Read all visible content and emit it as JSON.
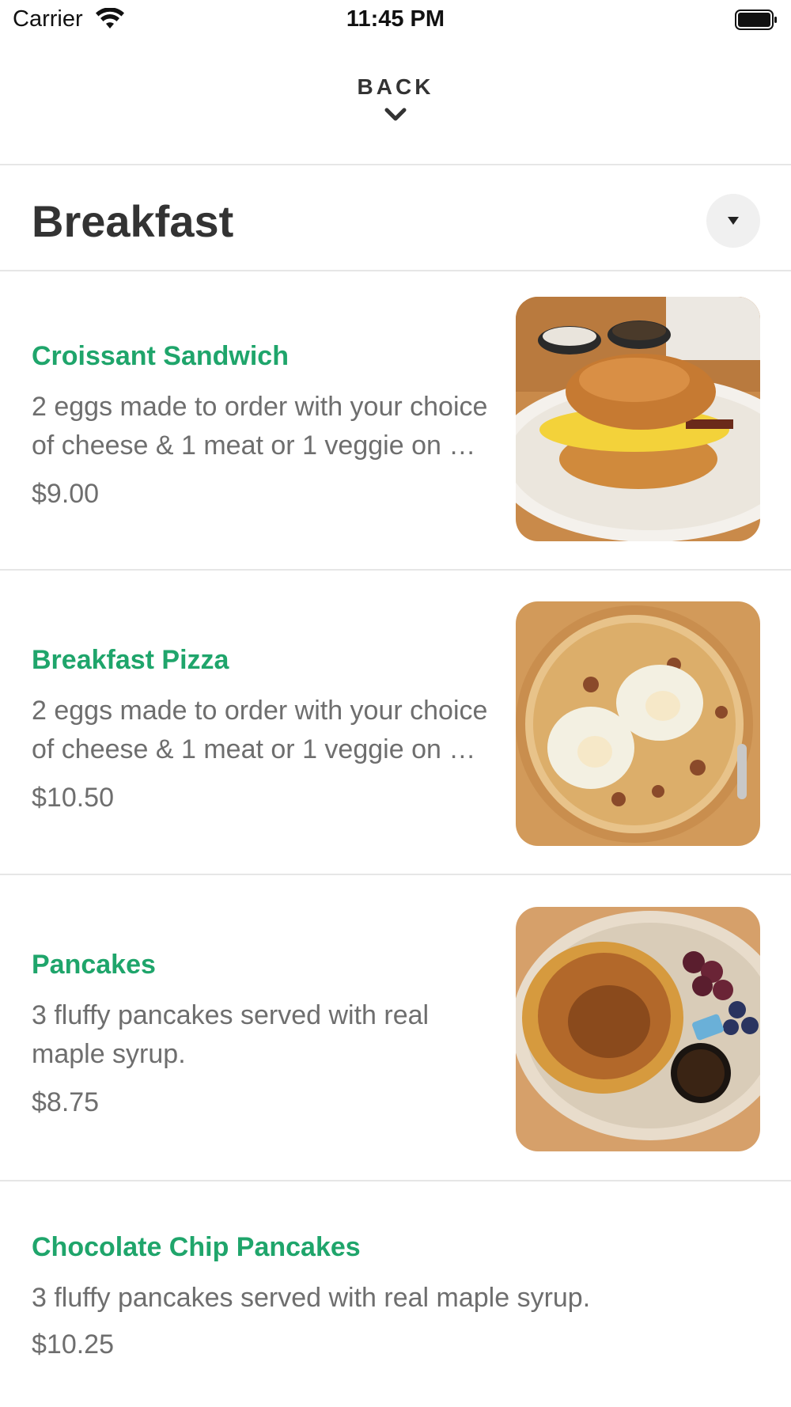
{
  "status_bar": {
    "carrier": "Carrier",
    "time": "11:45 PM",
    "wifi_icon": "wifi-icon",
    "battery_icon": "battery-icon"
  },
  "header": {
    "back_label": "BACK",
    "chevron_icon": "chevron-down-icon"
  },
  "category": {
    "title": "Breakfast",
    "toggle_icon": "caret-down-icon"
  },
  "menu": {
    "items": [
      {
        "name": "Croissant Sandwich",
        "description": "2 eggs made to order with your choice of cheese & 1 meat or 1 veggie on a toasted croissant.",
        "price": "$9.00",
        "photo": "croissant-sandwich-photo"
      },
      {
        "name": "Breakfast Pizza",
        "description": "2 eggs made to order with your choice of cheese & 1 meat or 1 veggie on a pizza crust.",
        "price": "$10.50",
        "photo": "breakfast-pizza-photo"
      },
      {
        "name": "Pancakes",
        "description": "3 fluffy pancakes served with real maple syrup.",
        "price": "$8.75",
        "photo": "pancakes-photo"
      },
      {
        "name": "Chocolate Chip Pancakes",
        "description": "3 fluffy pancakes served with real maple syrup.",
        "price": "$10.25"
      }
    ]
  },
  "colors": {
    "item_name": "#1fa56b",
    "text_muted": "#6e6e6e",
    "heading": "#333333",
    "divider": "#e6e6e6"
  }
}
